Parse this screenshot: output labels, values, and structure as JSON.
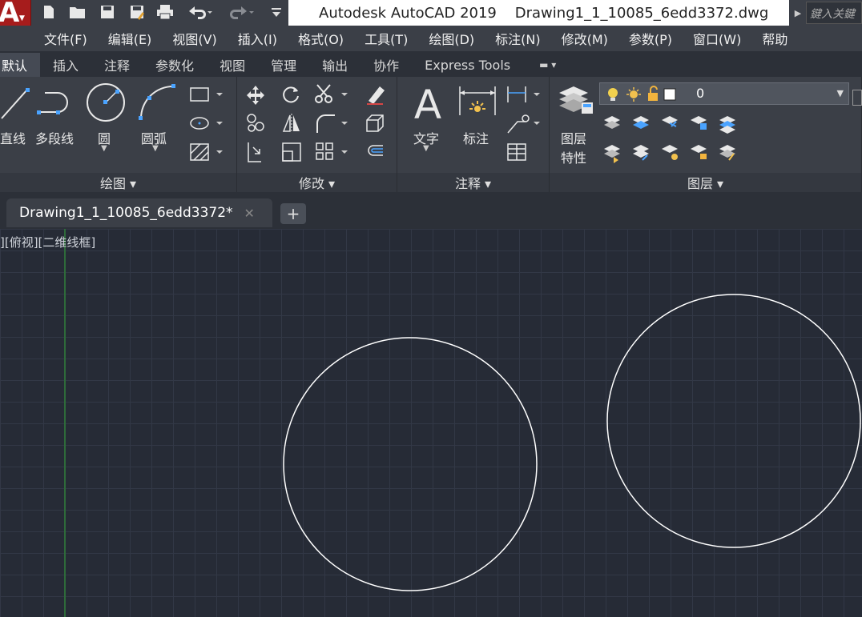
{
  "app": {
    "title": "Autodesk AutoCAD 2019    Drawing1_1_10085_6edd3372.dwg",
    "logo_letter": "A",
    "search_placeholder": "鍵入关鍵"
  },
  "menu": [
    "文件(F)",
    "编辑(E)",
    "视图(V)",
    "插入(I)",
    "格式(O)",
    "工具(T)",
    "绘图(D)",
    "标注(N)",
    "修改(M)",
    "参数(P)",
    "窗口(W)",
    "帮助"
  ],
  "ribbon_tabs": [
    "默认",
    "插入",
    "注释",
    "参数化",
    "视图",
    "管理",
    "输出",
    "协作",
    "Express Tools"
  ],
  "panels": {
    "draw": {
      "title": "绘图 ▾",
      "line": "直线",
      "polyline": "多段线",
      "circle": "圆",
      "arc": "圆弧"
    },
    "modify": {
      "title": "修改 ▾"
    },
    "annotation": {
      "title": "注释 ▾",
      "text": "文字",
      "dimension": "标注"
    },
    "layers": {
      "title": "图层 ▾",
      "layer_props_line1": "图层",
      "layer_props_line2": "特性",
      "current_layer": "0"
    }
  },
  "document": {
    "tab_label": "Drawing1_1_10085_6edd3372*",
    "viewport_label": "][俯视][二维线框]"
  },
  "colors": {
    "canvas": "#262b36",
    "app_button": "#a61c1c",
    "circle_stroke": "#ffffff"
  }
}
